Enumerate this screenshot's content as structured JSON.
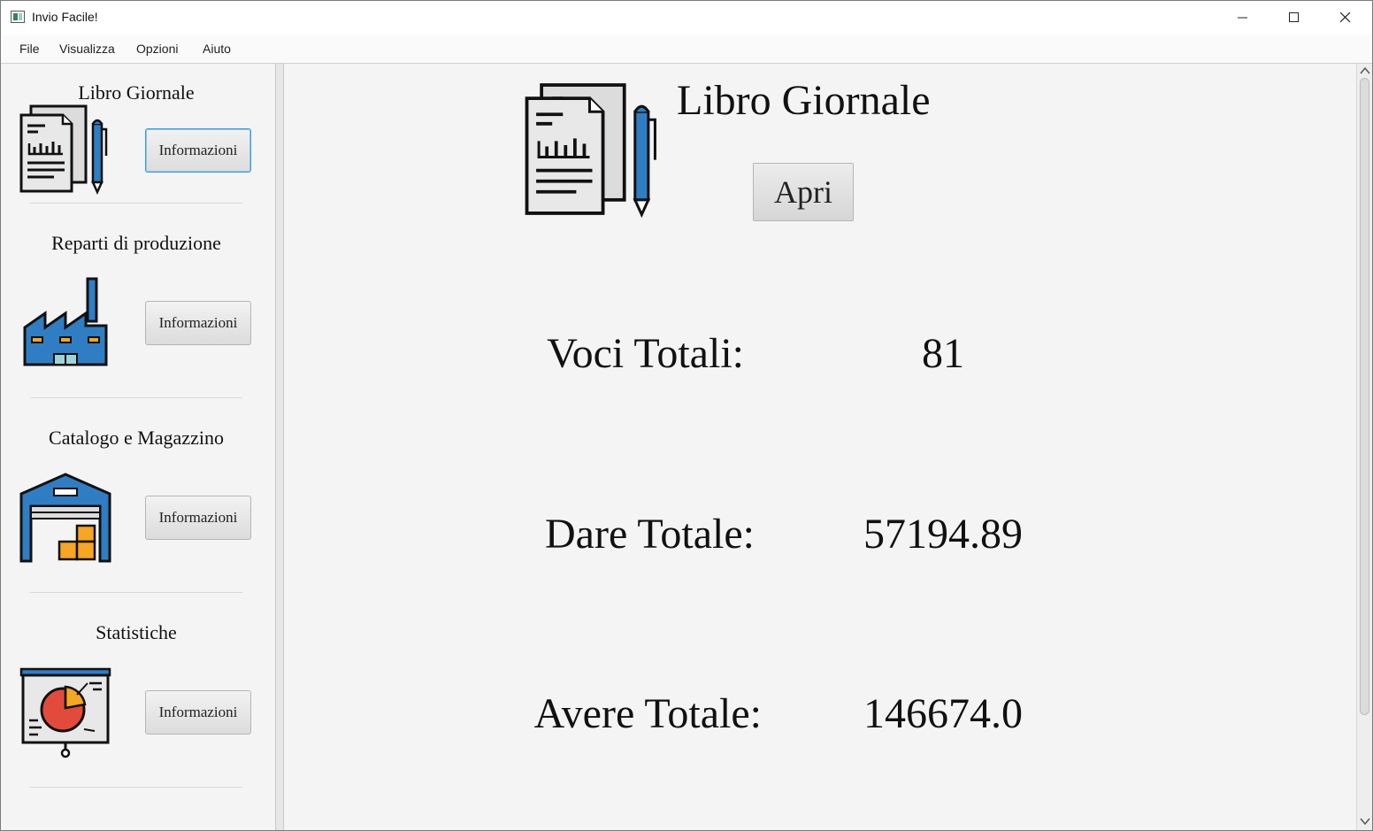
{
  "window": {
    "title": "Invio Facile!"
  },
  "menu": [
    {
      "label": "File"
    },
    {
      "label": "Visualizza"
    },
    {
      "label": "Opzioni"
    },
    {
      "label": "Aiuto"
    }
  ],
  "sidebar": {
    "sections": [
      {
        "title": "Libro Giornale",
        "button": "Informazioni",
        "icon": "ledger-document-icon"
      },
      {
        "title": "Reparti di produzione",
        "button": "Informazioni",
        "icon": "factory-icon"
      },
      {
        "title": "Catalogo e Magazzino",
        "button": "Informazioni",
        "icon": "warehouse-icon"
      },
      {
        "title": "Statistiche",
        "button": "Informazioni",
        "icon": "statistics-board-icon"
      }
    ]
  },
  "main": {
    "title": "Libro Giornale",
    "open_button": "Apri",
    "stats": [
      {
        "label": "Voci Totali:",
        "value": "81"
      },
      {
        "label": "Dare Totale:",
        "value": "57194.89"
      },
      {
        "label": "Avere Totale:",
        "value": "146674.0"
      }
    ]
  },
  "colors": {
    "icon_blue": "#2f7ec4",
    "box_orange": "#f6a623",
    "chart_red": "#e24b3b",
    "focus_blue": "#3a9ad9"
  }
}
